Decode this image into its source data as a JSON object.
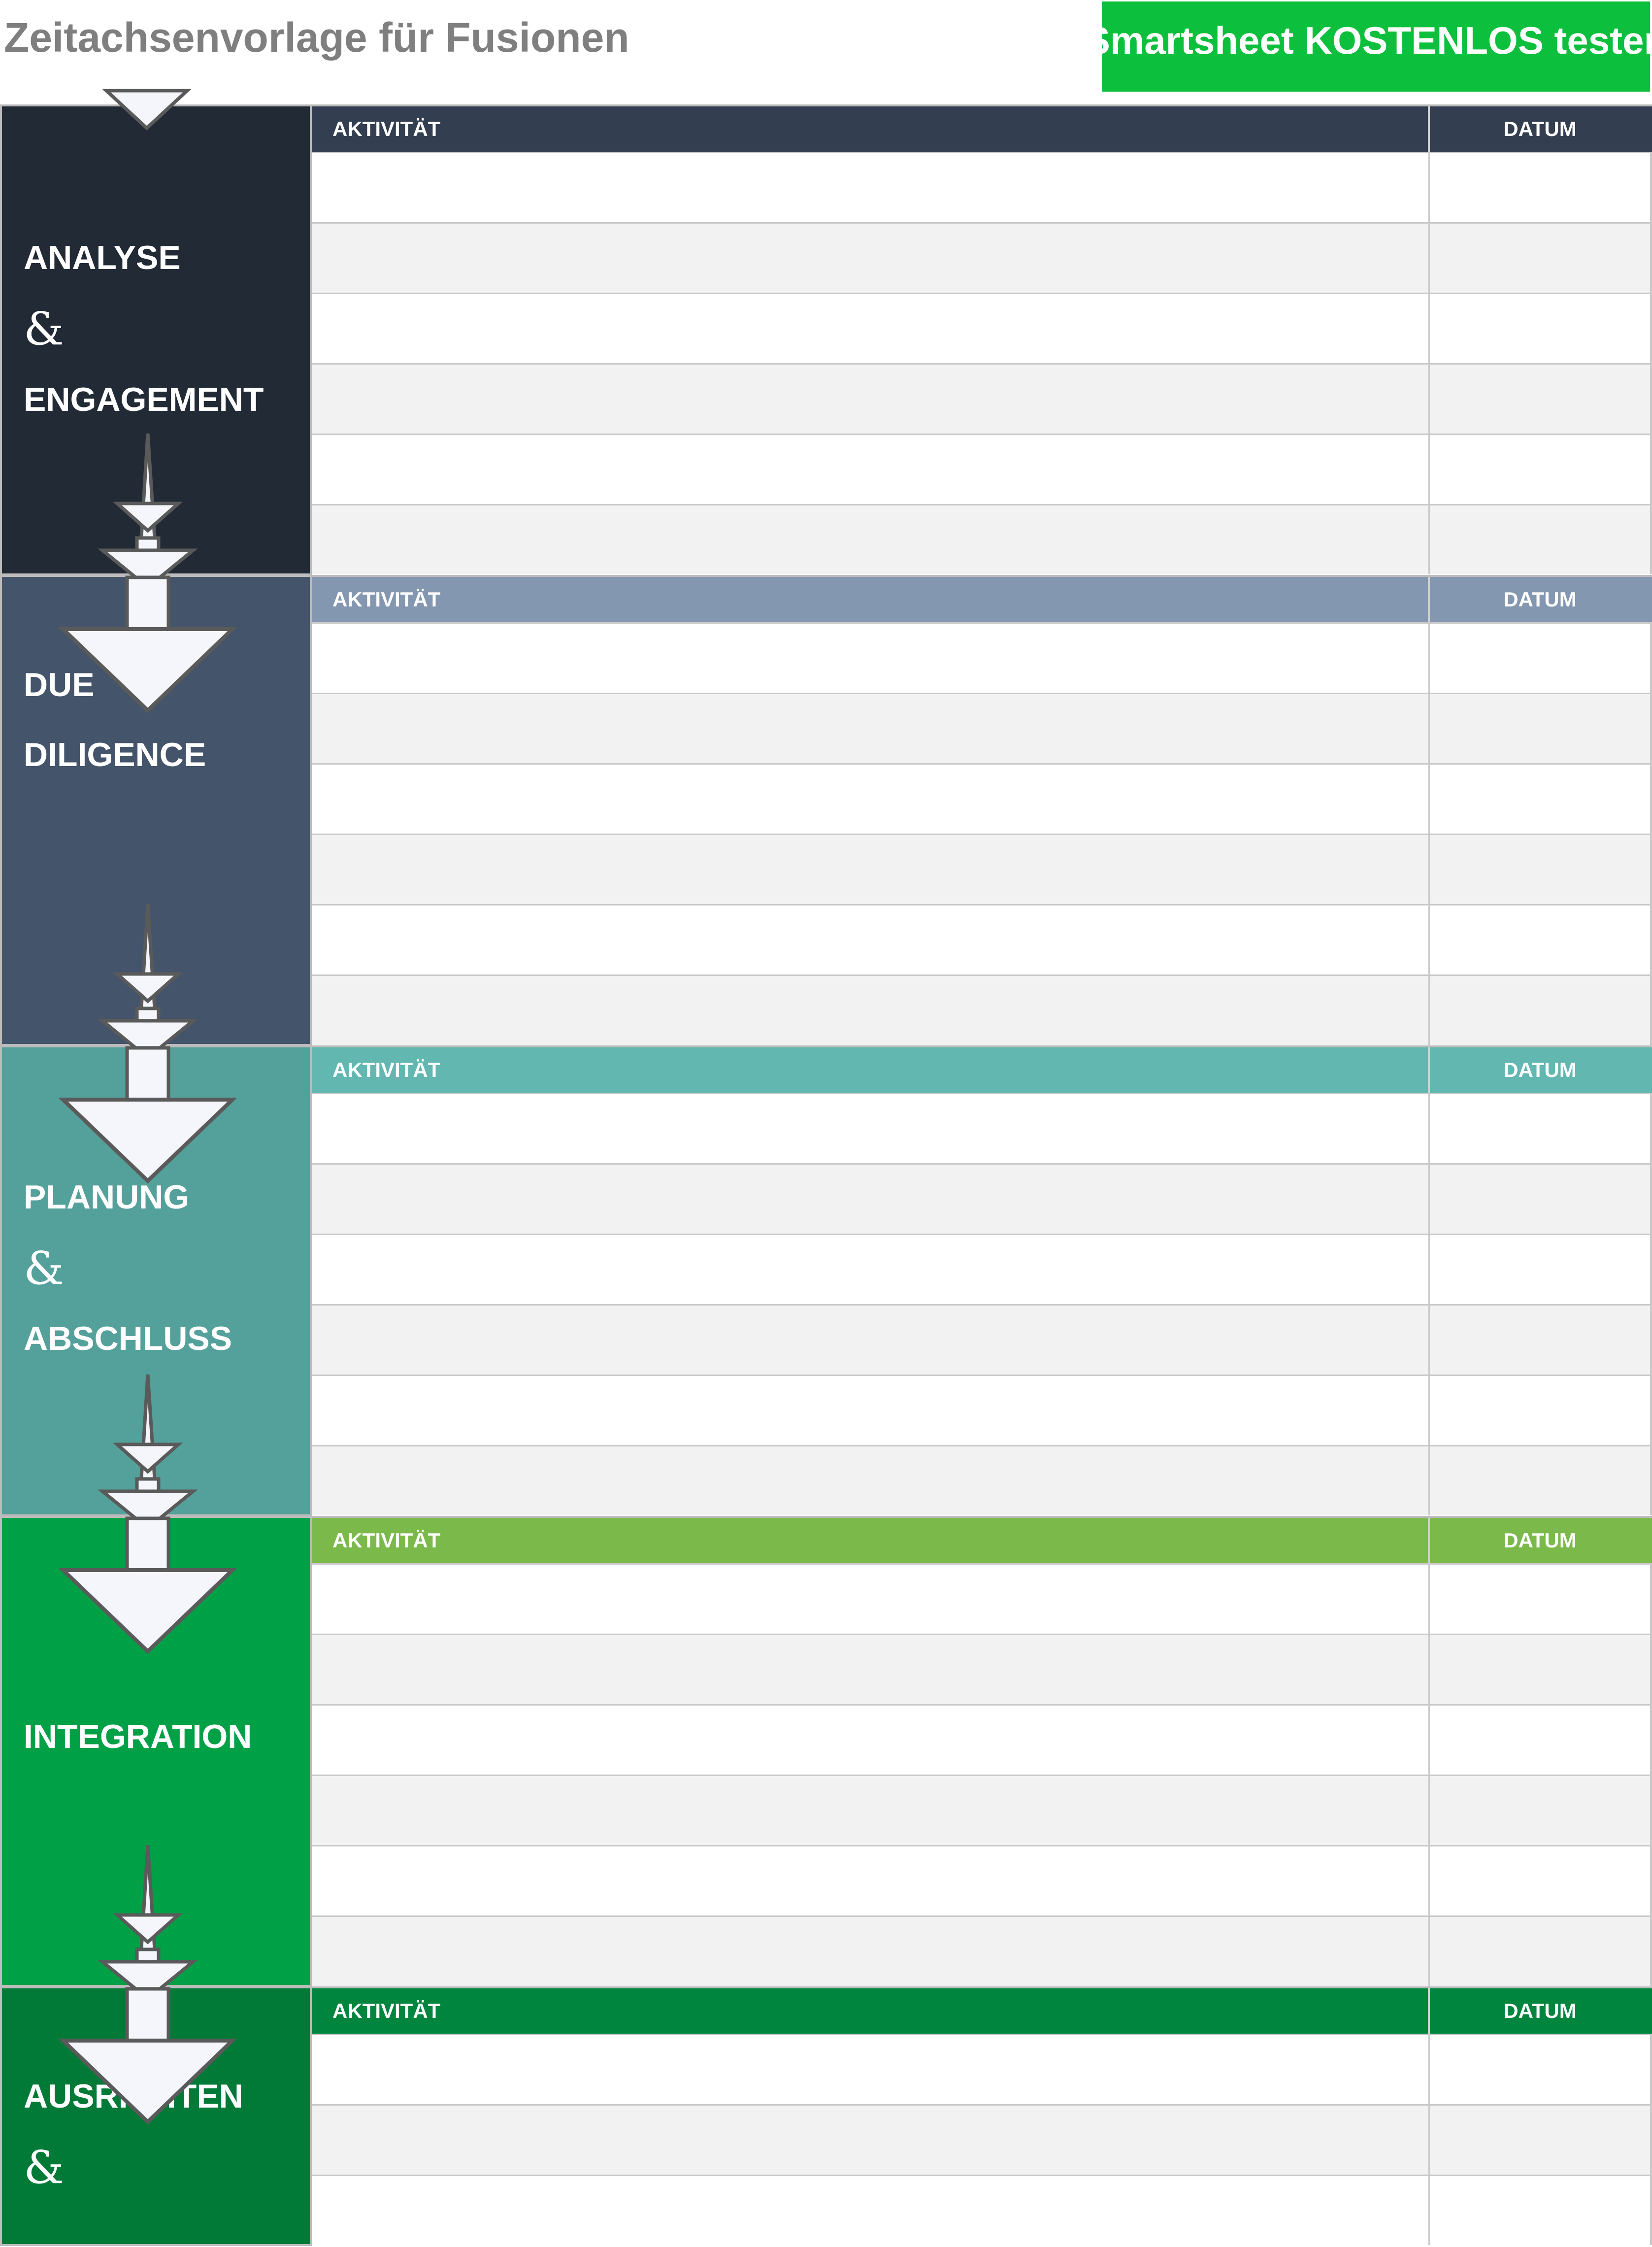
{
  "header": {
    "title": "Zeitachsenvorlage für Fusionen",
    "cta_label": "Smartsheet KOSTENLOS testen",
    "cta_color": "#0cbf3d"
  },
  "table_labels": {
    "activity": "AKTIVITÄT",
    "date": "DATUM"
  },
  "sections": [
    {
      "lines": [
        "ANALYSE",
        "&",
        "ENGAGEMENT"
      ],
      "phase_color": "#222a35",
      "header_color": "#333f50",
      "rows": [
        {
          "activity": "",
          "date": ""
        },
        {
          "activity": "",
          "date": ""
        },
        {
          "activity": "",
          "date": ""
        },
        {
          "activity": "",
          "date": ""
        },
        {
          "activity": "",
          "date": ""
        },
        {
          "activity": "",
          "date": ""
        }
      ]
    },
    {
      "lines": [
        "DUE",
        "DILIGENCE"
      ],
      "phase_color": "#44546a",
      "header_color": "#8497b0",
      "rows": [
        {
          "activity": "",
          "date": ""
        },
        {
          "activity": "",
          "date": ""
        },
        {
          "activity": "",
          "date": ""
        },
        {
          "activity": "",
          "date": ""
        },
        {
          "activity": "",
          "date": ""
        },
        {
          "activity": "",
          "date": ""
        }
      ]
    },
    {
      "lines": [
        "PLANUNG",
        "&",
        "ABSCHLUSS"
      ],
      "phase_color": "#54a09a",
      "header_color": "#62b8b1",
      "rows": [
        {
          "activity": "",
          "date": ""
        },
        {
          "activity": "",
          "date": ""
        },
        {
          "activity": "",
          "date": ""
        },
        {
          "activity": "",
          "date": ""
        },
        {
          "activity": "",
          "date": ""
        },
        {
          "activity": "",
          "date": ""
        }
      ]
    },
    {
      "lines": [
        "INTEGRATION"
      ],
      "phase_color": "#00a046",
      "header_color": "#7bb94a",
      "rows": [
        {
          "activity": "",
          "date": ""
        },
        {
          "activity": "",
          "date": ""
        },
        {
          "activity": "",
          "date": ""
        },
        {
          "activity": "",
          "date": ""
        },
        {
          "activity": "",
          "date": ""
        },
        {
          "activity": "",
          "date": ""
        }
      ]
    },
    {
      "lines": [
        "AUSRICHTEN",
        "&"
      ],
      "phase_color": "#007a36",
      "header_color": "#00853e",
      "rows": [
        {
          "activity": "",
          "date": ""
        },
        {
          "activity": "",
          "date": ""
        },
        {
          "activity": "",
          "date": ""
        }
      ]
    }
  ]
}
